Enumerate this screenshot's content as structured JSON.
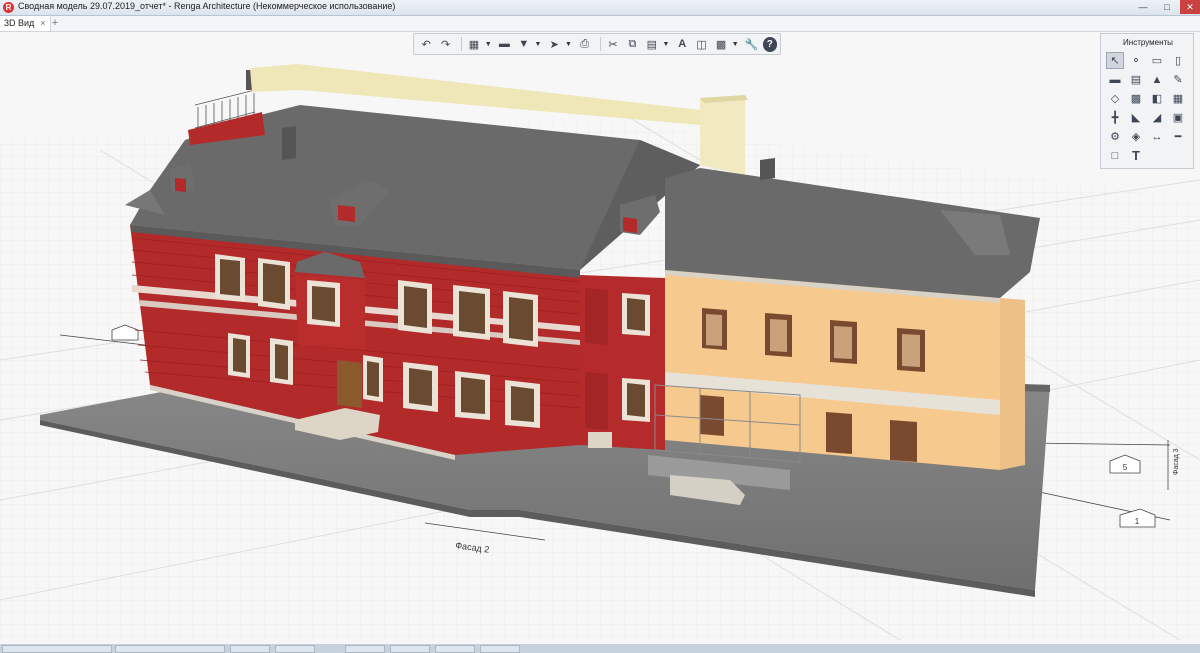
{
  "window": {
    "title": "Сводная модель 29.07.2019_отчет* - Renga Architecture (Некоммерческое использование)",
    "app_icon": "renga-logo-icon",
    "controls": [
      "minimize-icon",
      "maximize-icon",
      "close-icon"
    ]
  },
  "tabs": [
    {
      "label": "3D Вид",
      "active": true
    }
  ],
  "toolbar": {
    "buttons": [
      "undo-icon",
      "redo-icon",
      "view-cube-icon",
      "fill-icon",
      "stamp-icon",
      "export-icon",
      "print-icon",
      "cut-icon",
      "copy-icon",
      "paste-icon",
      "text-style-icon",
      "drawings-icon",
      "layers-icon",
      "settings-wrench-icon",
      "help-icon"
    ],
    "help_label": "?"
  },
  "tools_panel": {
    "title": "Инструменты",
    "text_tool_label": "T",
    "tools": [
      "select-icon",
      "axis-icon",
      "wall-icon",
      "column-icon",
      "slab-icon",
      "beam-icon",
      "roof-icon",
      "pencil-icon",
      "opening-icon",
      "floor-icon",
      "door-icon",
      "window-icon",
      "railing-icon",
      "stair-icon",
      "ramp-icon",
      "equipment-icon",
      "gear-component-icon",
      "model-element-icon",
      "dimension-icon",
      "level-icon",
      "room-icon",
      "text-icon"
    ]
  },
  "viewport": {
    "labels": {
      "facade_2": "Фасад 2",
      "facade_3": "Фасад 3",
      "axis_1": "1",
      "axis_5": "5"
    },
    "colors": {
      "grid_bg": "#f7f7f7",
      "roof": "#6b6b6b",
      "red_facade": "#b52a2a",
      "yellow_facade": "#f3c88c",
      "ground_slab": "#7a7a7a"
    }
  }
}
